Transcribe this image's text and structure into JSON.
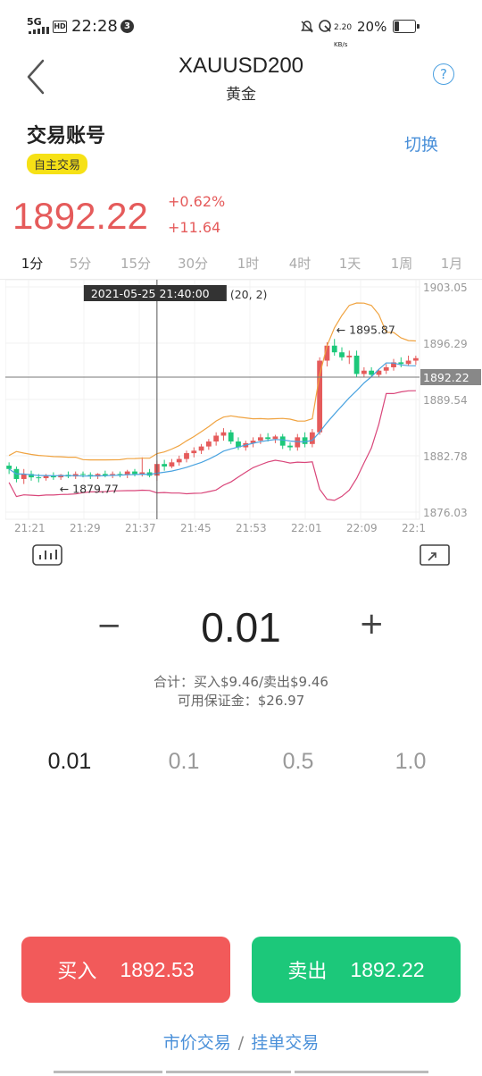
{
  "status": {
    "network": "5G",
    "hd": "HD",
    "time": "22:28",
    "notif_count": "3",
    "speed_top": "2.20",
    "speed_unit": "KB/s",
    "battery": "20%"
  },
  "header": {
    "title": "XAUUSD200",
    "subtitle": "黄金",
    "help": "?"
  },
  "account": {
    "label": "交易账号",
    "switch": "切换",
    "badge": "自主交易"
  },
  "quote": {
    "price": "1892.22",
    "change_pct": "+0.62%",
    "change_abs": "+11.64"
  },
  "timeframes": [
    "1分",
    "5分",
    "15分",
    "30分",
    "1时",
    "4时",
    "1天",
    "1周",
    "1月"
  ],
  "active_timeframe": "1分",
  "chart_data": {
    "type": "candlestick",
    "y_ticks": [
      "1903.05",
      "1896.29",
      "1889.54",
      "1882.78",
      "1876.03"
    ],
    "ylim": [
      1876.03,
      1903.05
    ],
    "x_ticks": [
      "21:21",
      "21:29",
      "21:37",
      "21:45",
      "21:53",
      "22:01",
      "22:09",
      "22:1"
    ],
    "crosshair_time": "2021-05-25 21:40:00",
    "crosshair_tag": "(20, 2)",
    "current_price_label": "1892.22",
    "max_label": "← 1895.87",
    "min_label": "← 1879.77",
    "colors": {
      "up": "#e55b5b",
      "down": "#1cc87a",
      "upper_band": "#f0a340",
      "middle_band": "#4aa3e0",
      "lower_band": "#d9467a"
    },
    "candles": [
      [
        1881.6,
        1882.0,
        1880.6,
        1881.2
      ],
      [
        1881.2,
        1881.5,
        1879.6,
        1880.0
      ],
      [
        1880.0,
        1881.2,
        1879.4,
        1880.6
      ],
      [
        1880.6,
        1881.0,
        1879.8,
        1880.2
      ],
      [
        1880.2,
        1880.6,
        1879.6,
        1880.1
      ],
      [
        1880.1,
        1880.6,
        1879.8,
        1880.4
      ],
      [
        1880.4,
        1880.8,
        1879.9,
        1880.2
      ],
      [
        1880.2,
        1880.6,
        1879.9,
        1880.5
      ],
      [
        1880.5,
        1880.9,
        1880.1,
        1880.3
      ],
      [
        1880.3,
        1880.9,
        1880.0,
        1880.6
      ],
      [
        1880.6,
        1880.9,
        1880.2,
        1880.5
      ],
      [
        1880.5,
        1880.8,
        1880.0,
        1880.3
      ],
      [
        1880.3,
        1880.7,
        1880.0,
        1880.6
      ],
      [
        1880.6,
        1881.0,
        1880.2,
        1880.4
      ],
      [
        1880.4,
        1880.9,
        1880.1,
        1880.6
      ],
      [
        1880.6,
        1880.9,
        1880.2,
        1880.5
      ],
      [
        1880.5,
        1881.1,
        1880.1,
        1880.9
      ],
      [
        1880.9,
        1881.2,
        1880.3,
        1880.6
      ],
      [
        1880.6,
        1882.6,
        1880.3,
        1880.8
      ],
      [
        1880.8,
        1881.2,
        1880.2,
        1880.4
      ],
      [
        1880.4,
        1882.2,
        1879.8,
        1881.8
      ],
      [
        1881.8,
        1882.3,
        1881.0,
        1881.5
      ],
      [
        1881.5,
        1882.4,
        1881.3,
        1882.0
      ],
      [
        1882.0,
        1882.8,
        1881.6,
        1882.4
      ],
      [
        1882.4,
        1883.4,
        1882.0,
        1883.1
      ],
      [
        1883.1,
        1883.8,
        1882.6,
        1883.4
      ],
      [
        1883.4,
        1884.2,
        1883.0,
        1883.9
      ],
      [
        1883.9,
        1884.8,
        1883.5,
        1884.5
      ],
      [
        1884.5,
        1885.6,
        1884.0,
        1885.2
      ],
      [
        1885.2,
        1886.1,
        1884.6,
        1885.6
      ],
      [
        1885.6,
        1885.9,
        1884.2,
        1884.5
      ],
      [
        1884.5,
        1885.0,
        1883.5,
        1883.8
      ],
      [
        1883.8,
        1884.6,
        1883.4,
        1884.3
      ],
      [
        1884.3,
        1885.0,
        1883.8,
        1884.6
      ],
      [
        1884.6,
        1885.4,
        1884.2,
        1885.0
      ],
      [
        1885.0,
        1885.5,
        1884.5,
        1884.8
      ],
      [
        1884.8,
        1885.3,
        1884.3,
        1885.1
      ],
      [
        1885.1,
        1885.4,
        1883.6,
        1884.0
      ],
      [
        1884.0,
        1884.4,
        1883.4,
        1883.8
      ],
      [
        1883.8,
        1885.4,
        1883.4,
        1885.0
      ],
      [
        1885.0,
        1885.6,
        1883.8,
        1884.2
      ],
      [
        1884.2,
        1886.0,
        1883.8,
        1885.6
      ],
      [
        1885.6,
        1894.6,
        1885.3,
        1894.2
      ],
      [
        1894.2,
        1896.4,
        1893.5,
        1896.0
      ],
      [
        1896.0,
        1896.8,
        1894.8,
        1895.2
      ],
      [
        1895.2,
        1895.8,
        1894.2,
        1894.6
      ],
      [
        1894.6,
        1895.4,
        1893.8,
        1894.8
      ],
      [
        1894.8,
        1895.4,
        1892.2,
        1892.6
      ],
      [
        1892.6,
        1893.4,
        1892.2,
        1893.0
      ],
      [
        1893.0,
        1893.4,
        1892.2,
        1892.5
      ],
      [
        1892.5,
        1893.2,
        1892.2,
        1893.0
      ],
      [
        1893.0,
        1893.8,
        1892.6,
        1893.4
      ],
      [
        1893.4,
        1894.4,
        1893.0,
        1894.0
      ],
      [
        1894.0,
        1894.6,
        1893.4,
        1893.8
      ],
      [
        1893.8,
        1894.8,
        1893.6,
        1894.2
      ],
      [
        1894.2,
        1894.8,
        1893.7,
        1894.5
      ]
    ]
  },
  "lot": {
    "minus": "−",
    "value": "0.01",
    "plus": "+",
    "total_line": "合计：买入$9.46/卖出$9.46",
    "margin_line": "可用保证金：$26.97",
    "presets": [
      "0.01",
      "0.1",
      "0.5",
      "1.0"
    ]
  },
  "actions": {
    "buy_label": "买入",
    "buy_price": "1892.53",
    "sell_label": "卖出",
    "sell_price": "1892.22"
  },
  "modes": {
    "market": "市价交易",
    "separator": "/",
    "pending": "挂单交易"
  }
}
